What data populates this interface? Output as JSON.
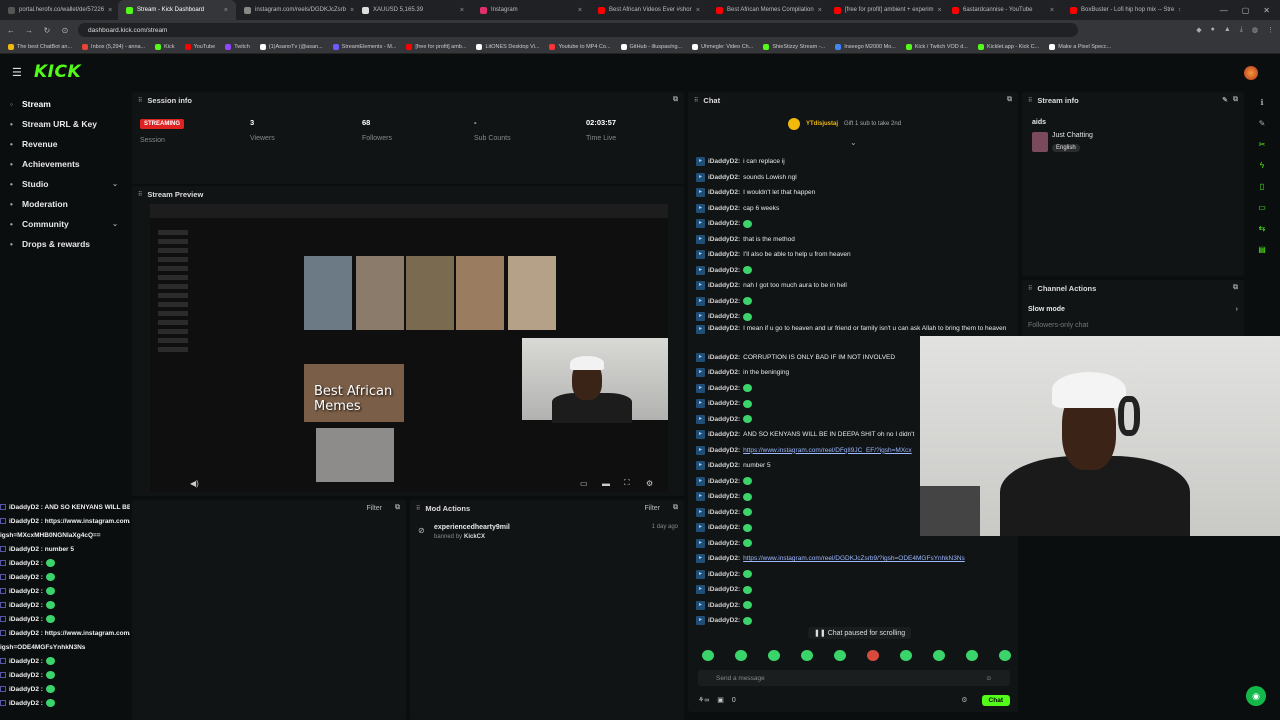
{
  "browser": {
    "tabs": [
      {
        "title": "portal.herofx.co/wallet/de/57226",
        "color": "#555555",
        "active": false
      },
      {
        "title": "Stream - Kick Dashboard",
        "color": "#53fc18",
        "active": true
      },
      {
        "title": "instagram.com/reels/DGDKJcZsrb",
        "color": "#888888",
        "active": false
      },
      {
        "title": "XAUUSD 5,165.39",
        "color": "#dddddd",
        "active": false
      },
      {
        "title": "Instagram",
        "color": "#e1306c",
        "active": false
      },
      {
        "title": "Best African Videos Ever #shor",
        "color": "#ff0000",
        "active": false
      },
      {
        "title": "Best African Memes Compilation",
        "color": "#ff0000",
        "active": false
      },
      {
        "title": "[free for profit] ambient + experim",
        "color": "#ff0000",
        "active": false
      },
      {
        "title": "6astardcannise - YouTube",
        "color": "#ff0000",
        "active": false
      },
      {
        "title": "BoxBuster - Lofi hip hop mix -- Stre",
        "color": "#ff0000",
        "active": false
      }
    ],
    "url": "dashboard.kick.com/stream",
    "bookmarks": [
      {
        "label": "The best ChatBot an...",
        "color": "#f0b90b"
      },
      {
        "label": "Inbox (5,294) - anna...",
        "color": "#ea4335"
      },
      {
        "label": "Kick",
        "color": "#53fc18"
      },
      {
        "label": "YouTube",
        "color": "#ff0000"
      },
      {
        "label": "Twitch",
        "color": "#9146ff"
      },
      {
        "label": "(1)AsanoTv (@asan...",
        "color": "#ffffff"
      },
      {
        "label": "StreamElements - M...",
        "color": "#6a5cff"
      },
      {
        "label": "[free for profit] amb...",
        "color": "#ff0000"
      },
      {
        "label": "LitONES Desktop Vi...",
        "color": "#ffffff"
      },
      {
        "label": "Youtube to MP4 Co...",
        "color": "#ff3333"
      },
      {
        "label": "GitHub - illuspas/ng...",
        "color": "#ffffff"
      },
      {
        "label": "Uhmegle: Video Ch...",
        "color": "#ffffff"
      },
      {
        "label": "ShieStizzy Stream -...",
        "color": "#53fc18"
      },
      {
        "label": "Inseego M2000 Mo...",
        "color": "#4285f4"
      },
      {
        "label": "Kick / Twitch VOD d...",
        "color": "#53fc18"
      },
      {
        "label": "Kicklet.app - Kick C...",
        "color": "#53fc18"
      },
      {
        "label": "Make a Pixel Specc...",
        "color": "#ffffff"
      }
    ]
  },
  "kick": {
    "logo": "KICK",
    "sidebar": [
      {
        "label": "Stream",
        "icon": "broadcast-icon",
        "chev": ""
      },
      {
        "label": "Stream URL & Key",
        "icon": "globe-icon",
        "chev": ""
      },
      {
        "label": "Revenue",
        "icon": "dollar-icon",
        "chev": ""
      },
      {
        "label": "Achievements",
        "icon": "trophy-icon",
        "chev": ""
      },
      {
        "label": "Studio",
        "icon": "studio-icon",
        "chev": "⌄"
      },
      {
        "label": "Moderation",
        "icon": "shield-icon",
        "chev": ""
      },
      {
        "label": "Community",
        "icon": "users-icon",
        "chev": "⌄"
      },
      {
        "label": "Drops & rewards",
        "icon": "gift-icon",
        "chev": ""
      }
    ],
    "session": {
      "title": "Session info",
      "status": "STREAMING",
      "status_label": "Session",
      "viewers": "3",
      "viewers_label": "Viewers",
      "followers": "68",
      "followers_label": "Followers",
      "subs": "-",
      "subs_label": "Sub Counts",
      "time": "02:03:57",
      "time_label": "Time Live"
    },
    "preview": {
      "title": "Stream Preview"
    },
    "filter_panel": {
      "filter_label": "Filter"
    },
    "mod_actions": {
      "title": "Mod Actions",
      "filter_label": "Filter",
      "entry_user": "experiencedhearty9mil",
      "entry_sub": "banned by",
      "entry_by": "KickCX",
      "entry_time": "1 day ago"
    },
    "chat": {
      "title": "Chat",
      "pinned_user": "YTdisjustaj",
      "pinned_text": "Gift 1 sub to take 2nd",
      "messages": [
        {
          "u": "iDaddyD2:",
          "t": "i can replace ij",
          "type": "text"
        },
        {
          "u": "iDaddyD2:",
          "t": "sounds Lowish ngl",
          "type": "text"
        },
        {
          "u": "iDaddyD2:",
          "t": "I wouldn't let that happen",
          "type": "text"
        },
        {
          "u": "iDaddyD2:",
          "t": "cap 6 weeks",
          "type": "text"
        },
        {
          "u": "iDaddyD2:",
          "t": "",
          "type": "emote"
        },
        {
          "u": "iDaddyD2:",
          "t": "that is the method",
          "type": "text"
        },
        {
          "u": "iDaddyD2:",
          "t": "I'll also be able to help u from heaven",
          "type": "text"
        },
        {
          "u": "iDaddyD2:",
          "t": "",
          "type": "emote"
        },
        {
          "u": "iDaddyD2:",
          "t": "nah I got too much aura to be in hell",
          "type": "text"
        },
        {
          "u": "iDaddyD2:",
          "t": "",
          "type": "emote"
        },
        {
          "u": "iDaddyD2:",
          "t": "",
          "type": "emote"
        },
        {
          "u": "iDaddyD2:",
          "t": "I mean if u go to heaven and ur friend or family isn't u can ask Allah to bring them to heaven",
          "type": "wrap"
        },
        {
          "u": "iDaddyD2:",
          "t": "CORRUPTION IS ONLY BAD IF IM NOT INVOLVED",
          "type": "text"
        },
        {
          "u": "iDaddyD2:",
          "t": "in the beninging",
          "type": "text"
        },
        {
          "u": "iDaddyD2:",
          "t": "",
          "type": "emote"
        },
        {
          "u": "iDaddyD2:",
          "t": "",
          "type": "emote"
        },
        {
          "u": "iDaddyD2:",
          "t": "",
          "type": "emote"
        },
        {
          "u": "iDaddyD2:",
          "t": "AND SO KENYANS WILL BE IN DEEPA SHIT oh no I didn't",
          "type": "text"
        },
        {
          "u": "iDaddyD2:",
          "t": "https://www.instagram.com/reel/DFqlI9JC_EF/?igsh=MXcx",
          "type": "link"
        },
        {
          "u": "iDaddyD2:",
          "t": "number 5",
          "type": "text"
        },
        {
          "u": "iDaddyD2:",
          "t": "",
          "type": "emote"
        },
        {
          "u": "iDaddyD2:",
          "t": "",
          "type": "emote"
        },
        {
          "u": "iDaddyD2:",
          "t": "",
          "type": "emote"
        },
        {
          "u": "iDaddyD2:",
          "t": "",
          "type": "emote"
        },
        {
          "u": "iDaddyD2:",
          "t": "",
          "type": "emote"
        },
        {
          "u": "iDaddyD2:",
          "t": "https://www.instagram.com/reel/DGDKJcZsrb9/?igsh=ODE4MGFsYnhkN3Ns",
          "type": "link"
        },
        {
          "u": "iDaddyD2:",
          "t": "",
          "type": "emote"
        },
        {
          "u": "iDaddyD2:",
          "t": "",
          "type": "emote"
        },
        {
          "u": "iDaddyD2:",
          "t": "",
          "type": "emote"
        },
        {
          "u": "iDaddyD2:",
          "t": "",
          "type": "emote"
        }
      ],
      "paused": "Chat paused for scrolling",
      "placeholder": "Send a message",
      "points": "0",
      "send_label": "Chat"
    },
    "stream_info": {
      "title": "Stream info",
      "stream_title": "aids",
      "category": "Just Chatting",
      "language": "English"
    },
    "channel_actions": {
      "title": "Channel Actions",
      "slow_mode": "Slow mode",
      "followers_only": "Followers-only chat"
    }
  },
  "console_log": [
    {
      "t": "iDaddyD2 : AND SO KENYANS WILL BE IN DEEPA SHIT oh no I didn't mean that",
      "type": "text"
    },
    {
      "t": "iDaddyD2 : https://www.instagram.com/reel/DFqlI9JC_EF/?",
      "type": "text"
    },
    {
      "t": "igsh=MXcxMHB0NGNlaXg4cQ==",
      "type": "cont"
    },
    {
      "t": "iDaddyD2 : number 5",
      "type": "text"
    },
    {
      "t": "iDaddyD2 :",
      "type": "emote"
    },
    {
      "t": "iDaddyD2 :",
      "type": "emote"
    },
    {
      "t": "iDaddyD2 :",
      "type": "emote"
    },
    {
      "t": "iDaddyD2 :",
      "type": "emote"
    },
    {
      "t": "iDaddyD2 :",
      "type": "emote"
    },
    {
      "t": "iDaddyD2 : https://www.instagram.com/reel/DGDKJcZsrb9/?",
      "type": "text"
    },
    {
      "t": "igsh=ODE4MGFsYnhkN3Ns",
      "type": "cont"
    },
    {
      "t": "iDaddyD2 :",
      "type": "emote"
    },
    {
      "t": "iDaddyD2 :",
      "type": "emote"
    },
    {
      "t": "iDaddyD2 :",
      "type": "emote"
    },
    {
      "t": "iDaddyD2 :",
      "type": "emote"
    }
  ],
  "preview_video": {
    "caption_title": "Best African Memes"
  },
  "colors": {
    "accent": "#53fc18",
    "live": "#dd2222",
    "bg": "#0b0e0f",
    "panel": "#111415"
  }
}
